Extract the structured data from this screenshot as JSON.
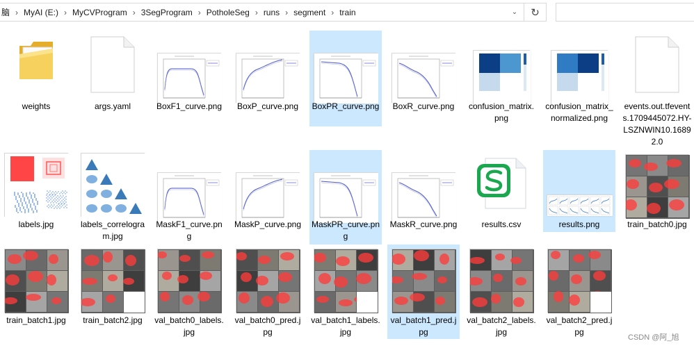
{
  "breadcrumb": [
    "脑",
    "MyAI (E:)",
    "MyCVProgram",
    "3SegProgram",
    "PotholeSeg",
    "runs",
    "segment",
    "train"
  ],
  "files": [
    {
      "id": "weights",
      "name": "weights",
      "kind": "folder"
    },
    {
      "id": "args",
      "name": "args.yaml",
      "kind": "doc"
    },
    {
      "id": "boxf1",
      "name": "BoxF1_curve.png",
      "kind": "plot-f1"
    },
    {
      "id": "boxp",
      "name": "BoxP_curve.png",
      "kind": "plot-p"
    },
    {
      "id": "boxpr",
      "name": "BoxPR_curve.png",
      "kind": "plot-pr",
      "selected": true
    },
    {
      "id": "boxr",
      "name": "BoxR_curve.png",
      "kind": "plot-r"
    },
    {
      "id": "conf",
      "name": "confusion_matrix.png",
      "kind": "confusion"
    },
    {
      "id": "confn",
      "name": "confusion_matrix_normalized.png",
      "kind": "confusion-n"
    },
    {
      "id": "events",
      "name": "events.out.tfevents.1709445072.HY-LSZNWIN10.16892.0",
      "kind": "doc"
    },
    {
      "id": "labels",
      "name": "labels.jpg",
      "kind": "labels"
    },
    {
      "id": "labelscorr",
      "name": "labels_correlogram.jpg",
      "kind": "correlogram"
    },
    {
      "id": "maskf1",
      "name": "MaskF1_curve.png",
      "kind": "plot-f1"
    },
    {
      "id": "maskp",
      "name": "MaskP_curve.png",
      "kind": "plot-p"
    },
    {
      "id": "maskpr",
      "name": "MaskPR_curve.png",
      "kind": "plot-pr",
      "selected": true
    },
    {
      "id": "maskr",
      "name": "MaskR_curve.png",
      "kind": "plot-r"
    },
    {
      "id": "resultscsv",
      "name": "results.csv",
      "kind": "csv"
    },
    {
      "id": "resultspng",
      "name": "results.png",
      "kind": "results",
      "selected": true
    },
    {
      "id": "trainb0",
      "name": "train_batch0.jpg",
      "kind": "photo-grid"
    },
    {
      "id": "trainb1",
      "name": "train_batch1.jpg",
      "kind": "photo-grid"
    },
    {
      "id": "trainb2",
      "name": "train_batch2.jpg",
      "kind": "photo-grid"
    },
    {
      "id": "val0l",
      "name": "val_batch0_labels.jpg",
      "kind": "photo-grid"
    },
    {
      "id": "val0p",
      "name": "val_batch0_pred.jpg",
      "kind": "photo-grid"
    },
    {
      "id": "val1l",
      "name": "val_batch1_labels.jpg",
      "kind": "photo-grid"
    },
    {
      "id": "val1p",
      "name": "val_batch1_pred.jpg",
      "kind": "photo-grid",
      "selected": true
    },
    {
      "id": "val2l",
      "name": "val_batch2_labels.jpg",
      "kind": "photo-grid"
    },
    {
      "id": "val2p",
      "name": "val_batch2_pred.jpg",
      "kind": "photo-grid"
    }
  ],
  "watermark": "CSDN @阿_旭",
  "colors": {
    "selection": "#cce8ff",
    "folder": "#f3c744",
    "csv_green": "#1aa84f",
    "mask_red": "#ff3b3b"
  }
}
